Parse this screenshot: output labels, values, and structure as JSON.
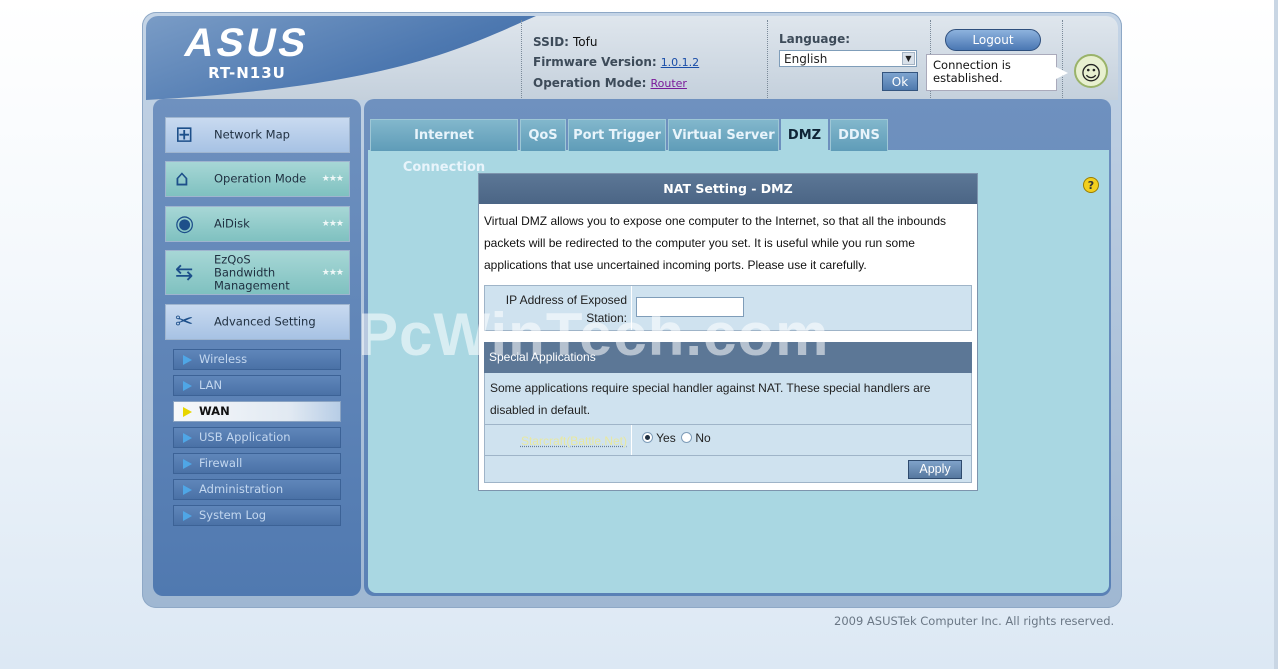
{
  "brand": {
    "name": "ASUS",
    "model": "RT-N13U"
  },
  "status": {
    "ssid_label": "SSID:",
    "ssid_value": "Tofu",
    "firmware_label": "Firmware Version:",
    "firmware_value": "1.0.1.2",
    "opmode_label": "Operation Mode:",
    "opmode_value": "Router"
  },
  "language": {
    "label": "Language:",
    "selected": "English",
    "ok_label": "Ok"
  },
  "logout_label": "Logout",
  "connection_status": "Connection is established.",
  "sidebar": {
    "main_items": [
      {
        "label": "Network Map"
      },
      {
        "label": "Operation Mode"
      },
      {
        "label": "AiDisk"
      },
      {
        "label": "EzQoS Bandwidth Management"
      },
      {
        "label": "Advanced Setting"
      }
    ],
    "sub_items": [
      {
        "label": "Wireless"
      },
      {
        "label": "LAN"
      },
      {
        "label": "WAN"
      },
      {
        "label": "USB Application"
      },
      {
        "label": "Firewall"
      },
      {
        "label": "Administration"
      },
      {
        "label": "System Log"
      }
    ]
  },
  "tabs": [
    {
      "label": "Internet Connection"
    },
    {
      "label": "QoS"
    },
    {
      "label": "Port Trigger"
    },
    {
      "label": "Virtual Server"
    },
    {
      "label": "DMZ"
    },
    {
      "label": "DDNS"
    }
  ],
  "panel": {
    "title": "NAT Setting - DMZ",
    "description": "Virtual DMZ allows you to expose one computer to the Internet, so that all the inbounds packets will be redirected to the computer you set. It is useful while you run some applications that use uncertained incoming ports. Please use it carefully.",
    "ip_label": "IP Address of Exposed Station:",
    "ip_value": "",
    "special_header": "Special Applications",
    "special_description": "Some applications require special handler against NAT. These special handlers are disabled in default.",
    "starcraft_label": "Starcraft(Battle.Net)",
    "yes_label": "Yes",
    "no_label": "No",
    "selected_option": "Yes",
    "apply_label": "Apply"
  },
  "copyright": "2009 ASUSTek Computer Inc. All rights reserved.",
  "watermark": "PcWinTech.com",
  "colors": {
    "header_blue": "#4d78b0",
    "content_bg": "#a9d7e2",
    "panel_title": "#5c7796",
    "active_sub": "#e8d600"
  }
}
